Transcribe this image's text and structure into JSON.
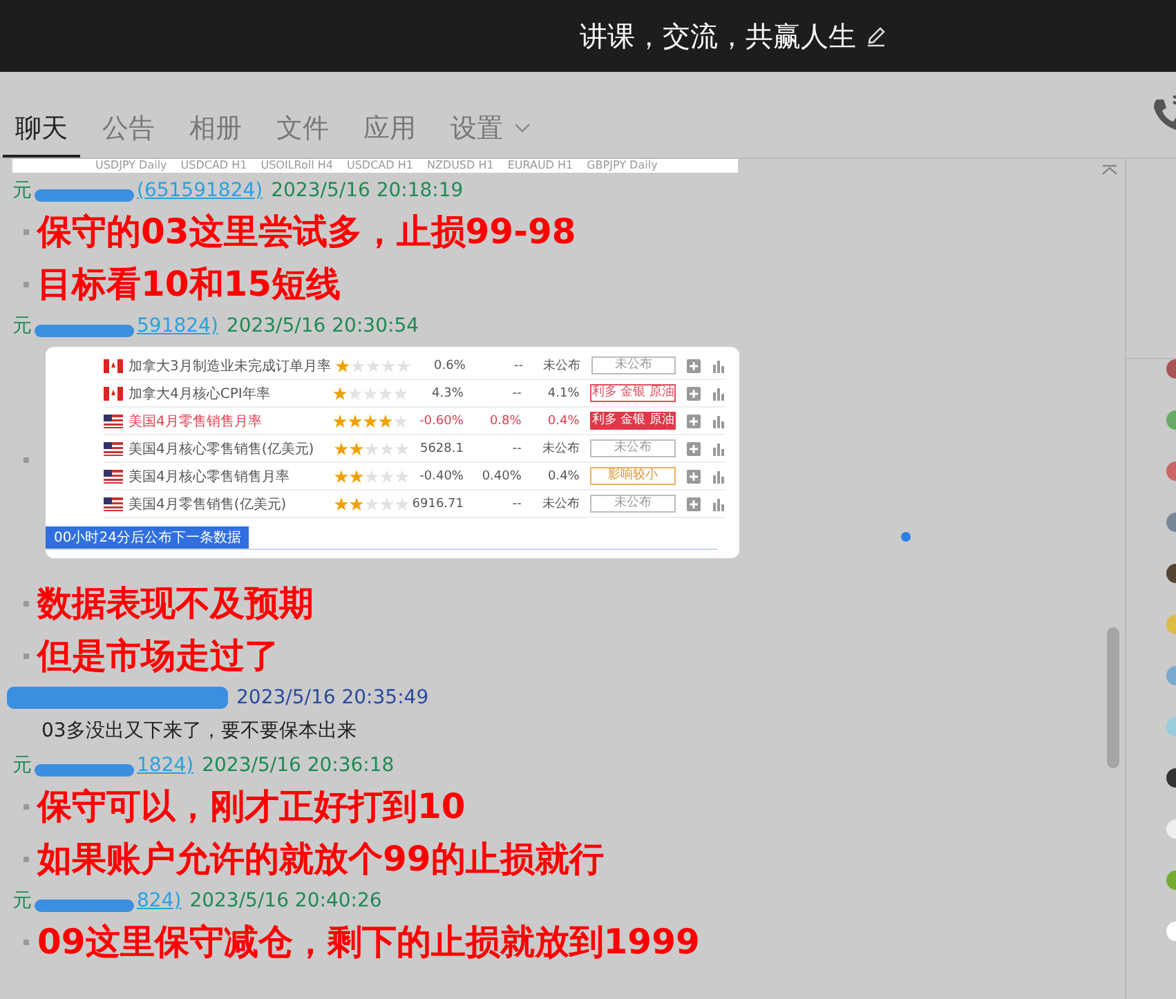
{
  "header": {
    "title": "讲课，交流，共赢人生"
  },
  "tabs": [
    {
      "label": "聊天",
      "selected": true,
      "dropdown": false
    },
    {
      "label": "公告",
      "selected": false,
      "dropdown": false
    },
    {
      "label": "相册",
      "selected": false,
      "dropdown": false
    },
    {
      "label": "文件",
      "selected": false,
      "dropdown": false
    },
    {
      "label": "应用",
      "selected": false,
      "dropdown": false
    },
    {
      "label": "设置",
      "selected": false,
      "dropdown": true
    }
  ],
  "chart_strip": {
    "labels": [
      "USDJPY Daily",
      "USDCAD H1",
      "USOILRoll H4",
      "USDCAD H1",
      "NZDUSD H1",
      "EURAUD H1",
      "GBPJPY Daily"
    ]
  },
  "messages": [
    {
      "sender": {
        "kind": "partial",
        "prefix": "元",
        "id": "(651591824)"
      },
      "time": "2023/5/16 20:18:19",
      "kind": "large",
      "lines": [
        "保守的03这里尝试多，止损99-98",
        "目标看10和15短线"
      ]
    },
    {
      "sender": {
        "kind": "partial",
        "prefix": "元",
        "id": "591824)"
      },
      "time": "2023/5/16 20:30:54",
      "kind": "image",
      "table": {
        "rows": [
          {
            "kind": "canada",
            "name": "加拿大3月制造业未完成订单月率",
            "highlight": false,
            "stars": 1,
            "previous": "0.6%",
            "forecast": "--",
            "actual": "未公布",
            "tag": {
              "text": "未公布",
              "kind": "plain"
            }
          },
          {
            "kind": "canada",
            "name": "加拿大4月核心CPI年率",
            "highlight": false,
            "stars": 1,
            "previous": "4.3%",
            "forecast": "--",
            "actual": "4.1%",
            "tag": {
              "text": "利多 金银 原油",
              "kind": "outline"
            }
          },
          {
            "kind": "usa",
            "name": "美国4月零售销售月率",
            "highlight": true,
            "stars": 4,
            "previous": "-0.60%",
            "forecast": "0.8%",
            "actual": "0.4%",
            "tag": {
              "text": "利多 金银 原油",
              "kind": "filled"
            }
          },
          {
            "kind": "usa",
            "name": "美国4月核心零售销售(亿美元)",
            "highlight": false,
            "stars": 2,
            "previous": "5628.1",
            "forecast": "--",
            "actual": "未公布",
            "tag": {
              "text": "未公布",
              "kind": "plain"
            }
          },
          {
            "kind": "usa",
            "name": "美国4月核心零售销售月率",
            "highlight": false,
            "stars": 2,
            "previous": "-0.40%",
            "forecast": "0.40%",
            "actual": "0.4%",
            "tag": {
              "text": "影响较小",
              "kind": "minor"
            }
          },
          {
            "kind": "usa",
            "name": "美国4月零售销售(亿美元)",
            "highlight": false,
            "stars": 2,
            "previous": "6916.71",
            "forecast": "--",
            "actual": "未公布",
            "tag": {
              "text": "未公布",
              "kind": "plain"
            }
          }
        ],
        "footer": "00小时24分后公布下一条数据"
      },
      "lines": [
        "数据表现不及预期",
        "但是市场走过了"
      ]
    },
    {
      "sender": {
        "kind": "hidden"
      },
      "time": "2023/5/16 20:35:49",
      "kind": "plain",
      "lines": [
        "03多没出又下来了，要不要保本出来"
      ]
    },
    {
      "sender": {
        "kind": "partial",
        "prefix": "元",
        "id": "1824)"
      },
      "time": "2023/5/16 20:36:18",
      "kind": "large",
      "lines": [
        "保守可以，刚才正好打到10",
        "如果账户允许的就放个99的止损就行"
      ]
    },
    {
      "sender": {
        "kind": "partial",
        "prefix": "元",
        "id": "824)"
      },
      "time": "2023/5/16 20:40:26",
      "kind": "large",
      "lines": [
        "09这里保守减仓，剩下的止损就放到1999"
      ]
    }
  ]
}
